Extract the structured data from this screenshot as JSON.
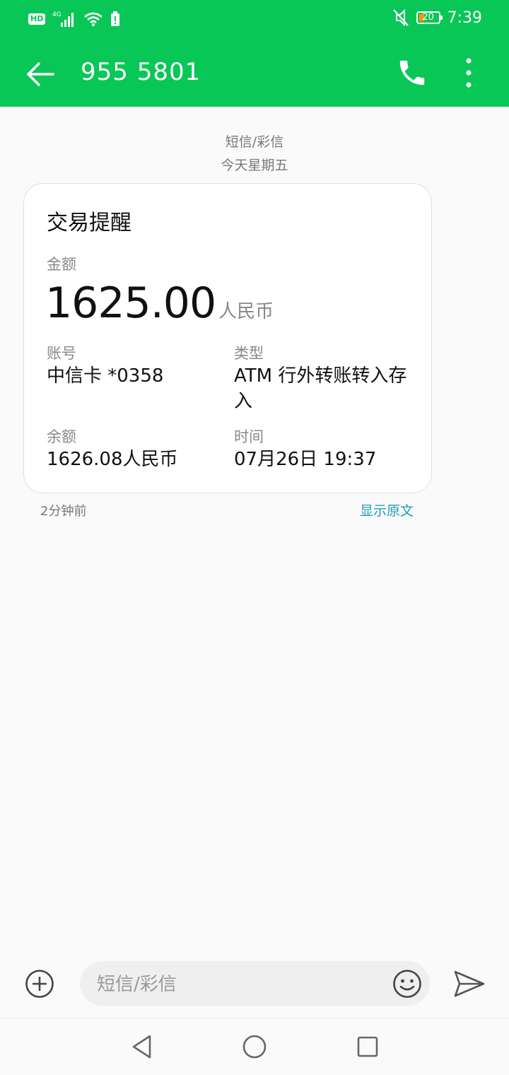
{
  "status_bar": {
    "hd_label": "HD",
    "network_label": "4G",
    "battery_percent": "20",
    "time": "7:39"
  },
  "header": {
    "title": "955 5801",
    "icons": [
      "back-arrow-icon",
      "phone-icon",
      "more-vert-icon"
    ]
  },
  "thread": {
    "type_label": "短信/彩信",
    "date_label": "今天星期五"
  },
  "card": {
    "title": "交易提醒",
    "amount_label": "金额",
    "amount_value": "1625.00",
    "amount_unit": "人民币",
    "account_label": "账号",
    "account_value": "中信卡 *0358",
    "type_label": "类型",
    "type_value": "ATM 行外转账转入存入",
    "balance_label": "余额",
    "balance_value": "1626.08人民币",
    "time_label": "时间",
    "time_value": "07月26日 19:37"
  },
  "message_meta": {
    "relative_time": "2分钟前",
    "show_original": "显示原文"
  },
  "compose": {
    "placeholder": "短信/彩信"
  },
  "colors": {
    "brand_green": "#08c756",
    "link_teal": "#1e9fb6",
    "battery_orange": "#ff9800"
  }
}
